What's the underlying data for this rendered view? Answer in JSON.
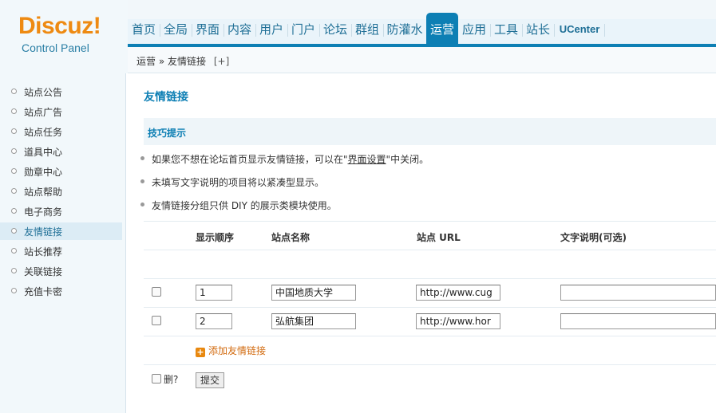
{
  "logo": {
    "brand": "Discuz!",
    "subtitle": "Control Panel"
  },
  "nav": {
    "tabs": [
      "首页",
      "全局",
      "界面",
      "内容",
      "用户",
      "门户",
      "论坛",
      "群组",
      "防灌水",
      "运营",
      "应用",
      "工具",
      "站长",
      "UCenter"
    ],
    "active": "运营"
  },
  "breadcrumb": {
    "section": "运营",
    "separator": "»",
    "page": "友情链接",
    "plus": "[+]"
  },
  "sidebar": {
    "items": [
      "站点公告",
      "站点广告",
      "站点任务",
      "道具中心",
      "勋章中心",
      "站点帮助",
      "电子商务",
      "友情链接",
      "站长推荐",
      "关联链接",
      "充值卡密"
    ],
    "active": "友情链接"
  },
  "page": {
    "title": "友情链接"
  },
  "tips": {
    "title": "技巧提示",
    "t1_before": "如果您不想在论坛首页显示友情链接，可以在\"",
    "t1_link": "界面设置",
    "t1_after": "\"中关闭。",
    "t2": "未填写文字说明的项目将以紧凑型显示。",
    "t3": "友情链接分组只供 DIY 的展示类模块使用。"
  },
  "table": {
    "headers": {
      "order": "显示顺序",
      "name": "站点名称",
      "url": "站点 URL",
      "desc": "文字说明(可选)"
    },
    "rows": [
      {
        "order": "1",
        "name": "中国地质大学",
        "url": "http://www.cug",
        "desc": ""
      },
      {
        "order": "2",
        "name": "弘航集团",
        "url": "http://www.hor",
        "desc": ""
      }
    ]
  },
  "add_link": "添加友情链接",
  "delete_label": "删?",
  "submit_label": "提交",
  "colors": {
    "accent": "#0d7fb4",
    "brand": "#ee8a12",
    "add_link": "#d26a0e"
  }
}
